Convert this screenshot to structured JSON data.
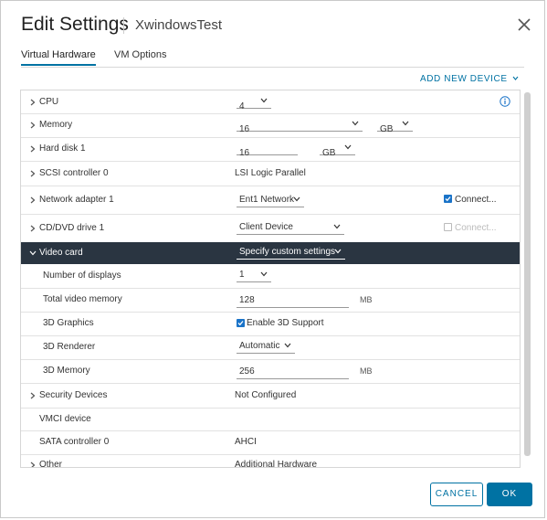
{
  "dialog": {
    "title": "Edit Settings",
    "subtitle": "XwindowsTest",
    "tabs": [
      {
        "label": "Virtual Hardware",
        "active": true
      },
      {
        "label": "VM Options",
        "active": false
      }
    ],
    "add_device": "ADD NEW DEVICE",
    "buttons": {
      "cancel": "CANCEL",
      "ok": "OK"
    }
  },
  "rows": {
    "cpu": {
      "label": "CPU",
      "value": "4"
    },
    "memory": {
      "label": "Memory",
      "value": "16",
      "unit": "GB"
    },
    "harddisk": {
      "label": "Hard disk 1",
      "value": "16",
      "unit": "GB"
    },
    "scsi": {
      "label": "SCSI controller 0",
      "value": "LSI Logic Parallel"
    },
    "network": {
      "label": "Network adapter 1",
      "value": "Ent1 Network",
      "connect_label": "Connect...",
      "connected": true
    },
    "cddvd": {
      "label": "CD/DVD drive 1",
      "value": "Client Device",
      "connect_label": "Connect...",
      "connected": false
    },
    "videocard": {
      "label": "Video card",
      "value": "Specify custom settings"
    },
    "num_displays": {
      "label": "Number of displays",
      "value": "1"
    },
    "total_video_memory": {
      "label": "Total video memory",
      "value": "128",
      "unit": "MB"
    },
    "graphics3d": {
      "label": "3D Graphics",
      "checkbox_label": "Enable 3D Support",
      "checked": true
    },
    "renderer3d": {
      "label": "3D Renderer",
      "value": "Automatic"
    },
    "memory3d": {
      "label": "3D Memory",
      "value": "256",
      "unit": "MB"
    },
    "security": {
      "label": "Security Devices",
      "value": "Not Configured"
    },
    "vmci": {
      "label": "VMCI device"
    },
    "sata": {
      "label": "SATA controller 0",
      "value": "AHCI"
    },
    "other": {
      "label": "Other",
      "value": "Additional Hardware"
    }
  },
  "colors": {
    "accent": "#0072a3",
    "selected_row": "#2a3541",
    "checkbox": "#1a73c8"
  }
}
